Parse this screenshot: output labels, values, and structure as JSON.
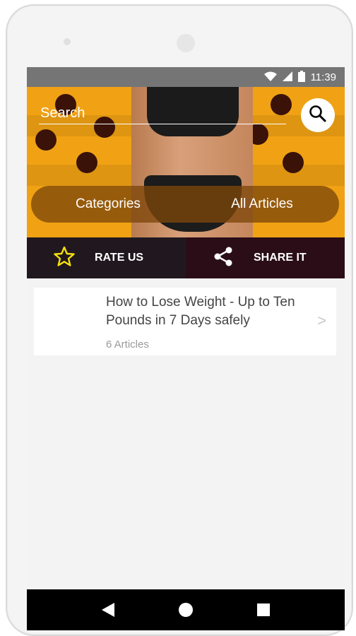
{
  "status_bar": {
    "time": "11:39",
    "icons": [
      "wifi-icon",
      "cellular-signal-icon",
      "battery-icon"
    ]
  },
  "header": {
    "search": {
      "placeholder": "Search",
      "value": ""
    },
    "search_button_icon": "search-icon"
  },
  "nav_pills": [
    {
      "label": "Categories"
    },
    {
      "label": "All Articles"
    }
  ],
  "actions": {
    "rate": {
      "label": "RATE US",
      "icon": "star-icon"
    },
    "share": {
      "label": "SHARE IT",
      "icon": "share-icon"
    }
  },
  "articles": [
    {
      "title": "How to Lose Weight - Up to Ten Pounds in 7 Days safely",
      "count": "6 Articles",
      "chevron": ">"
    }
  ],
  "system_nav": [
    "back-icon",
    "home-icon",
    "recents-icon"
  ],
  "colors": {
    "header_orange": "#f0a214",
    "pill_overlay": "#7d460a",
    "rate_bg": "#21181f",
    "share_bg": "#2a0d17",
    "star_yellow": "#f4e10d"
  }
}
